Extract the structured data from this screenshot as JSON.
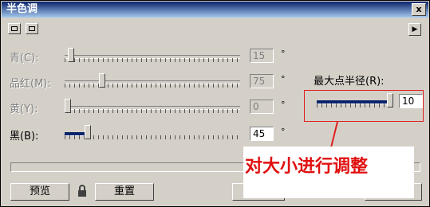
{
  "window": {
    "title": "半色调",
    "close_glyph": "x"
  },
  "sliders": [
    {
      "label": "青(C):",
      "value": "15",
      "unit": "°",
      "enabled": false,
      "level": 0.0
    },
    {
      "label": "品红(M):",
      "value": "75",
      "unit": "°",
      "enabled": false,
      "level": 0.2
    },
    {
      "label": "黄(Y):",
      "value": "0",
      "unit": "°",
      "enabled": false,
      "level": 0.0
    },
    {
      "label": "黑(B):",
      "value": "45",
      "unit": "°",
      "enabled": true,
      "level": 0.12
    }
  ],
  "radius": {
    "label": "最大点半径(R):",
    "value": "10",
    "level": 1.0
  },
  "annotation": {
    "text": "对大小进行调整",
    "color": "#e01010"
  },
  "buttons": {
    "preview": "预览",
    "reset": "重置"
  }
}
